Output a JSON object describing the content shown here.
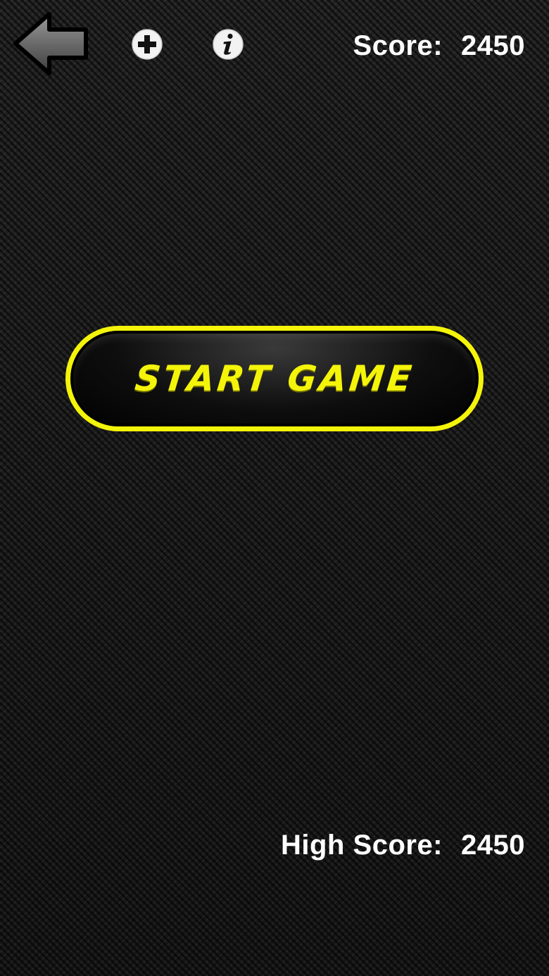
{
  "header": {
    "back_icon": "back-arrow-icon",
    "add_icon": "plus-circle-icon",
    "info_icon": "info-circle-icon",
    "score_label": "Score:",
    "score_value": "2450"
  },
  "main": {
    "start_label": "START GAME"
  },
  "footer": {
    "high_score_label": "High Score:",
    "high_score_value": "2450"
  },
  "colors": {
    "accent": "#f4f40a",
    "text": "#ffffff",
    "background": "#1c1c1c"
  }
}
